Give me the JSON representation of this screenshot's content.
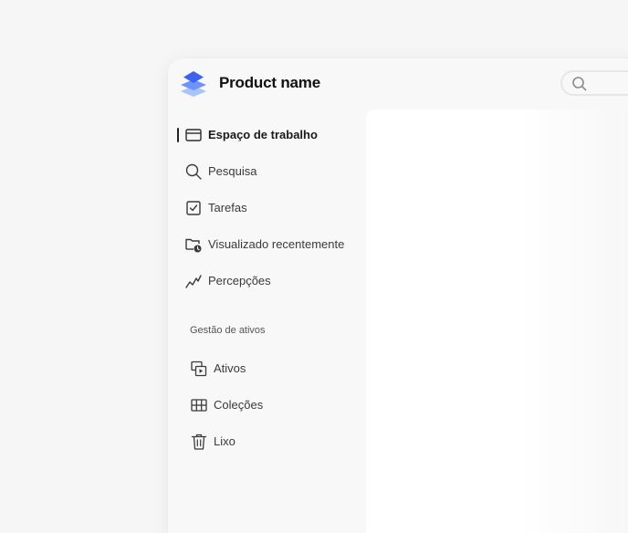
{
  "header": {
    "product_name": "Product name",
    "logo_icon": "layers-logo-icon",
    "search_icon": "search-icon"
  },
  "nav": {
    "items": [
      {
        "label": "Espaço de trabalho",
        "icon": "workspace-icon",
        "active": true
      },
      {
        "label": "Pesquisa",
        "icon": "search-icon",
        "active": false
      },
      {
        "label": "Tarefas",
        "icon": "checkbox-icon",
        "active": false
      },
      {
        "label": "Visualizado recentemente",
        "icon": "folder-clock-icon",
        "active": false
      },
      {
        "label": "Percepções",
        "icon": "trend-icon",
        "active": false
      }
    ]
  },
  "asset_management": {
    "heading": "Gestão de ativos",
    "items": [
      {
        "label": "Ativos",
        "icon": "assets-icon"
      },
      {
        "label": "Coleções",
        "icon": "grid-icon"
      },
      {
        "label": "Lixo",
        "icon": "trash-icon"
      }
    ]
  },
  "colors": {
    "logo_dark": "#3b63f0",
    "logo_mid": "#6f93f7",
    "logo_light": "#a9c3fb",
    "background": "#f6f6f6",
    "panel": "#ffffff"
  }
}
